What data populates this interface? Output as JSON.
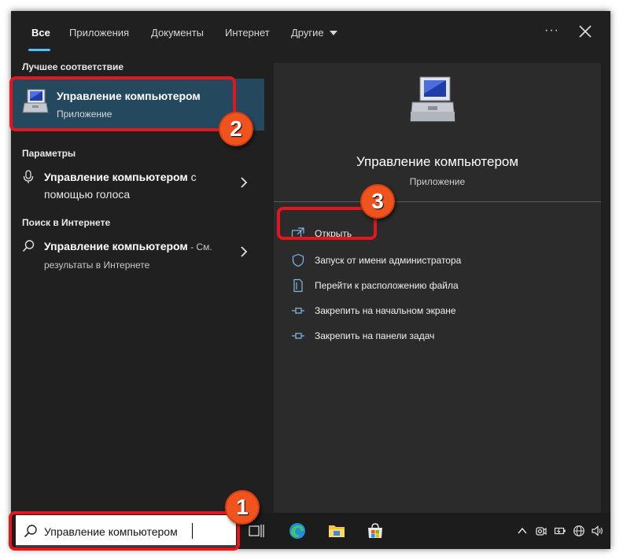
{
  "tabs": [
    {
      "label": "Все",
      "active": true
    },
    {
      "label": "Приложения"
    },
    {
      "label": "Документы"
    },
    {
      "label": "Интернет"
    },
    {
      "label": "Другие"
    }
  ],
  "header": {
    "more_icon": "ellipsis-icon",
    "close_icon": "close-icon"
  },
  "left": {
    "best_match_heading": "Лучшее соответствие",
    "best_match": {
      "title": "Управление компьютером",
      "subtitle": "Приложение",
      "icon": "computer-management-icon"
    },
    "settings_heading": "Параметры",
    "settings_result": {
      "bold": "Управление компьютером",
      "rest": " с помощью голоса"
    },
    "web_heading": "Поиск в Интернете",
    "web_result": {
      "bold": "Управление компьютером",
      "rest": " - См.",
      "small": "результаты в Интернете"
    }
  },
  "detail": {
    "title": "Управление компьютером",
    "subtitle": "Приложение",
    "actions": [
      {
        "label": "Открыть",
        "icon": "open-icon"
      },
      {
        "label": "Запуск от имени администратора",
        "icon": "shield-icon"
      },
      {
        "label": "Перейти к расположению файла",
        "icon": "file-location-icon"
      },
      {
        "label": "Закрепить на начальном экране",
        "icon": "pin-icon"
      },
      {
        "label": "Закрепить на панели задач",
        "icon": "pin-icon"
      }
    ]
  },
  "taskbar": {
    "search_value": "Управление компьютером",
    "apps": [
      "task-view-icon",
      "edge-icon",
      "file-explorer-icon",
      "store-icon"
    ],
    "tray": [
      "chevron-up-icon",
      "camera-icon",
      "battery-icon",
      "globe-icon",
      "volume-icon"
    ]
  },
  "annotations": [
    "1",
    "2",
    "3"
  ],
  "colors": {
    "accent": "#4cc2ff",
    "highlight": "#e3161c",
    "badge": "#f0531e",
    "selected": "#24485e"
  }
}
